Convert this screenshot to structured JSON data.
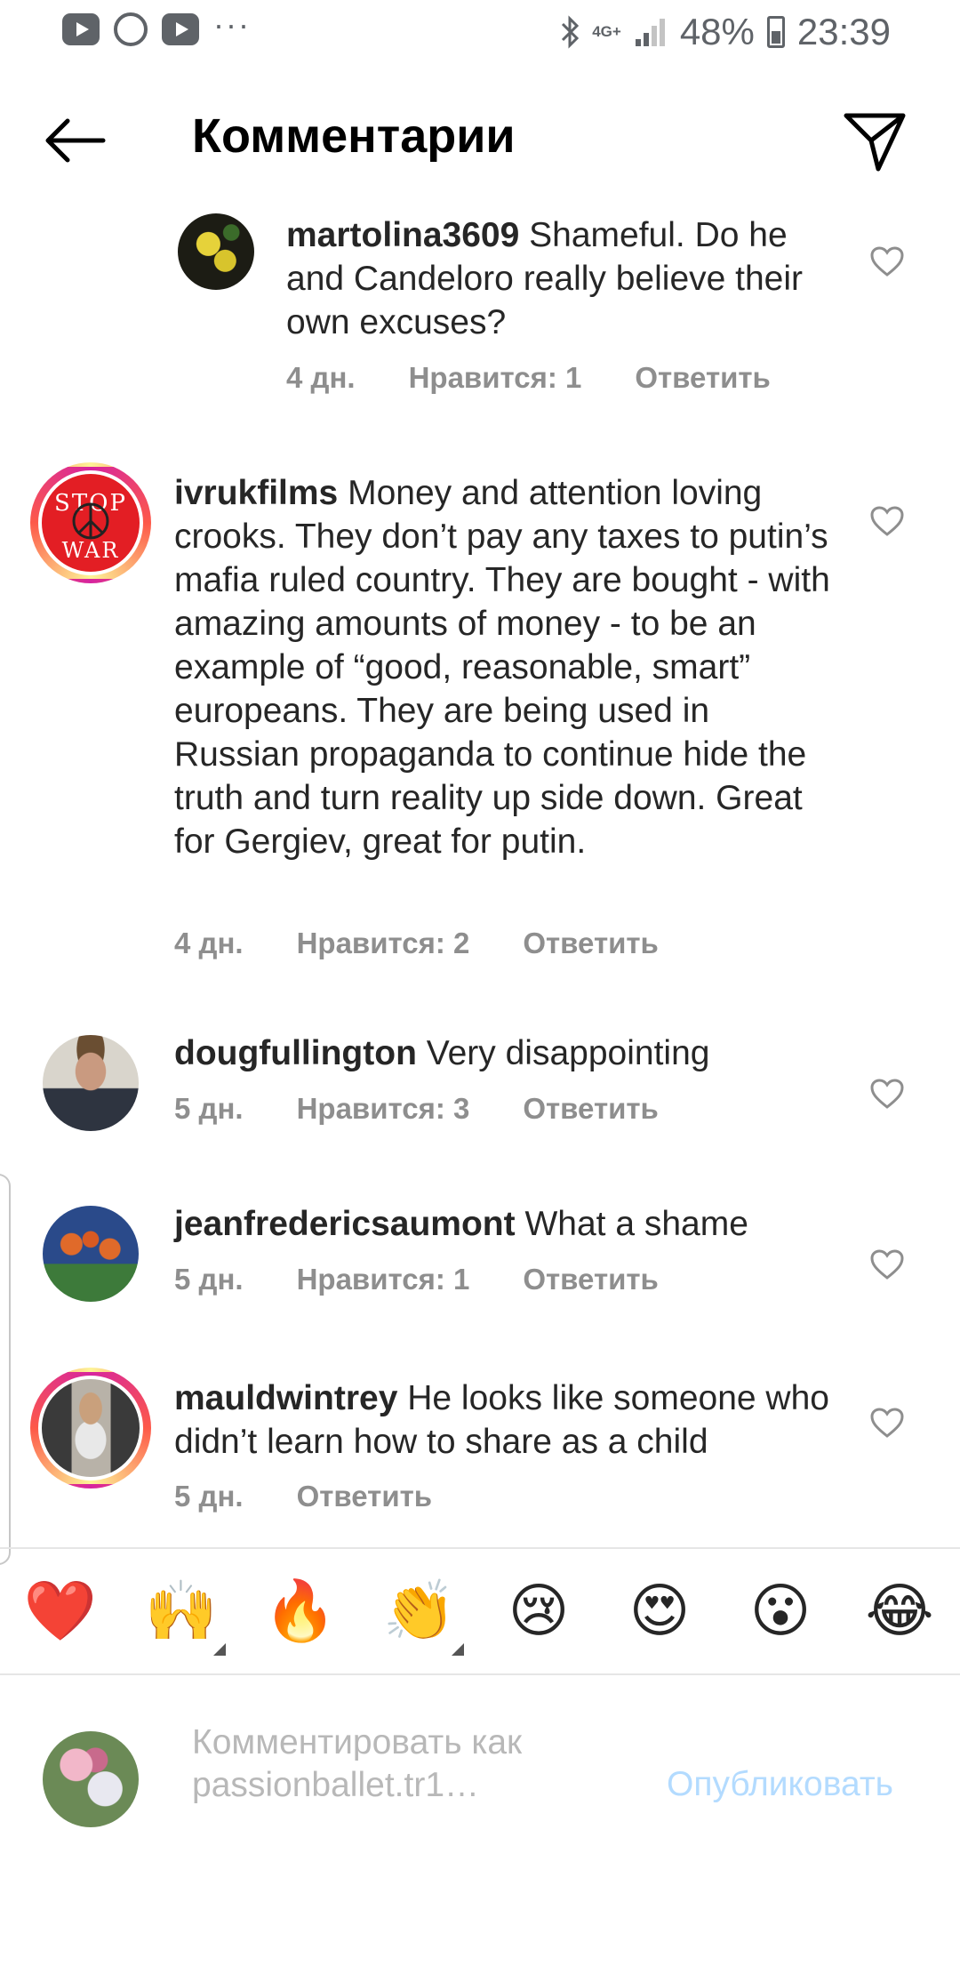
{
  "status_bar": {
    "apps": [
      "youtube-icon",
      "whatsapp-icon",
      "youtube-icon"
    ],
    "overflow": "···",
    "network": "4G+",
    "battery": "48%",
    "time": "23:39"
  },
  "header": {
    "title": "Комментарии",
    "back_icon": "arrow-left-icon",
    "send_icon": "paper-plane-icon"
  },
  "comments": [
    {
      "username": "martolina3609",
      "text": "Shameful.  Do he and Candeloro really believe their own excuses?",
      "age": "4 дн.",
      "likes": "Нравится: 1",
      "reply": "Ответить"
    },
    {
      "username": "ivrukfilms",
      "text": "Money and attention loving crooks. They don’t pay any taxes to putin’s mafia ruled country. They are bought - with amazing amounts of money - to be an example of “good, reasonable, smart” europeans. They are being used in Russian propaganda to continue hide the truth and turn reality up side down. Great for Gergiev, great for putin.",
      "age": "4 дн.",
      "likes": "Нравится: 2",
      "reply": "Ответить",
      "avatar_text": [
        "STOP",
        "WAR"
      ]
    },
    {
      "username": "dougfullington",
      "text": "Very disappointing",
      "age": "5 дн.",
      "likes": "Нравится: 3",
      "reply": "Ответить"
    },
    {
      "username": "jeanfredericsaumont",
      "text": "What a shame",
      "age": "5 дн.",
      "likes": "Нравится: 1",
      "reply": "Ответить"
    },
    {
      "username": "mauldwintrey",
      "text": "He looks like someone who didn’t learn how to share as a child",
      "age": "5 дн.",
      "reply": "Ответить"
    }
  ],
  "emoji_bar": [
    "❤️",
    "🙌",
    "🔥",
    "👏",
    "😢",
    "😍",
    "😮",
    "😂"
  ],
  "composer": {
    "placeholder": "Комментировать как passionballet.tr1…",
    "publish_label": "Опубликовать"
  },
  "colors": {
    "text": "#262626",
    "meta": "#8e8e8e",
    "publish_disabled": "#b3dbff"
  }
}
